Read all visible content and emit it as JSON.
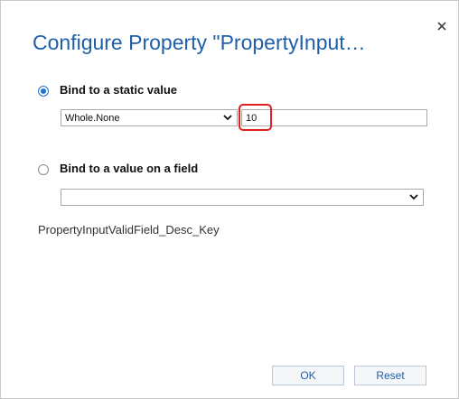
{
  "dialog": {
    "title": "Configure Property \"PropertyInput…",
    "close_icon": "close-icon"
  },
  "static_option": {
    "label": "Bind to a static value",
    "selected": true,
    "type_select_value": "Whole.None",
    "value_input": "10"
  },
  "field_option": {
    "label": "Bind to a value on a field",
    "selected": false,
    "field_select_value": ""
  },
  "description": "PropertyInputValidField_Desc_Key",
  "buttons": {
    "ok_label": "OK",
    "reset_label": "Reset"
  },
  "colors": {
    "accent": "#1f5fa8",
    "highlight": "#e01f1f"
  }
}
